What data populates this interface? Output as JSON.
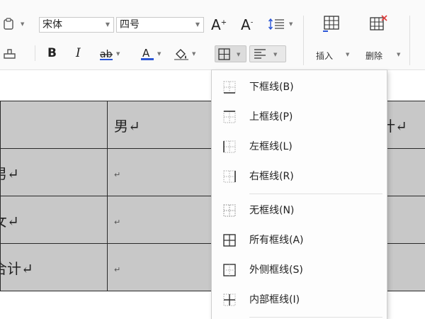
{
  "ribbon": {
    "font_name": "宋体",
    "font_size": "四号",
    "increase_font_glyph": "A",
    "increase_font_sup": "+",
    "decrease_font_glyph": "A",
    "decrease_font_sup": "-",
    "bold_glyph": "B",
    "italic_glyph": "I",
    "insert_label": "插入",
    "delete_label": "删除"
  },
  "table": {
    "rows": [
      [
        "",
        "男↵",
        "计↵"
      ],
      [
        "男↵",
        "↵",
        ""
      ],
      [
        "女↵",
        "↵",
        ""
      ],
      [
        "合计↵",
        "↵",
        ""
      ]
    ]
  },
  "border_menu": {
    "items": [
      {
        "label": "下框线(B)",
        "icon": "border-bottom-icon"
      },
      {
        "label": "上框线(P)",
        "icon": "border-top-icon"
      },
      {
        "label": "左框线(L)",
        "icon": "border-left-icon"
      },
      {
        "label": "右框线(R)",
        "icon": "border-right-icon"
      },
      {
        "label": "无框线(N)",
        "icon": "border-none-icon"
      },
      {
        "label": "所有框线(A)",
        "icon": "border-all-icon"
      },
      {
        "label": "外侧框线(S)",
        "icon": "border-outside-icon"
      },
      {
        "label": "内部框线(I)",
        "icon": "border-inside-icon"
      }
    ]
  },
  "colors": {
    "font_color_underline": "#2b56d6",
    "table_cell_bg": "#c8c8c8",
    "delete_badge": "#e04040"
  }
}
